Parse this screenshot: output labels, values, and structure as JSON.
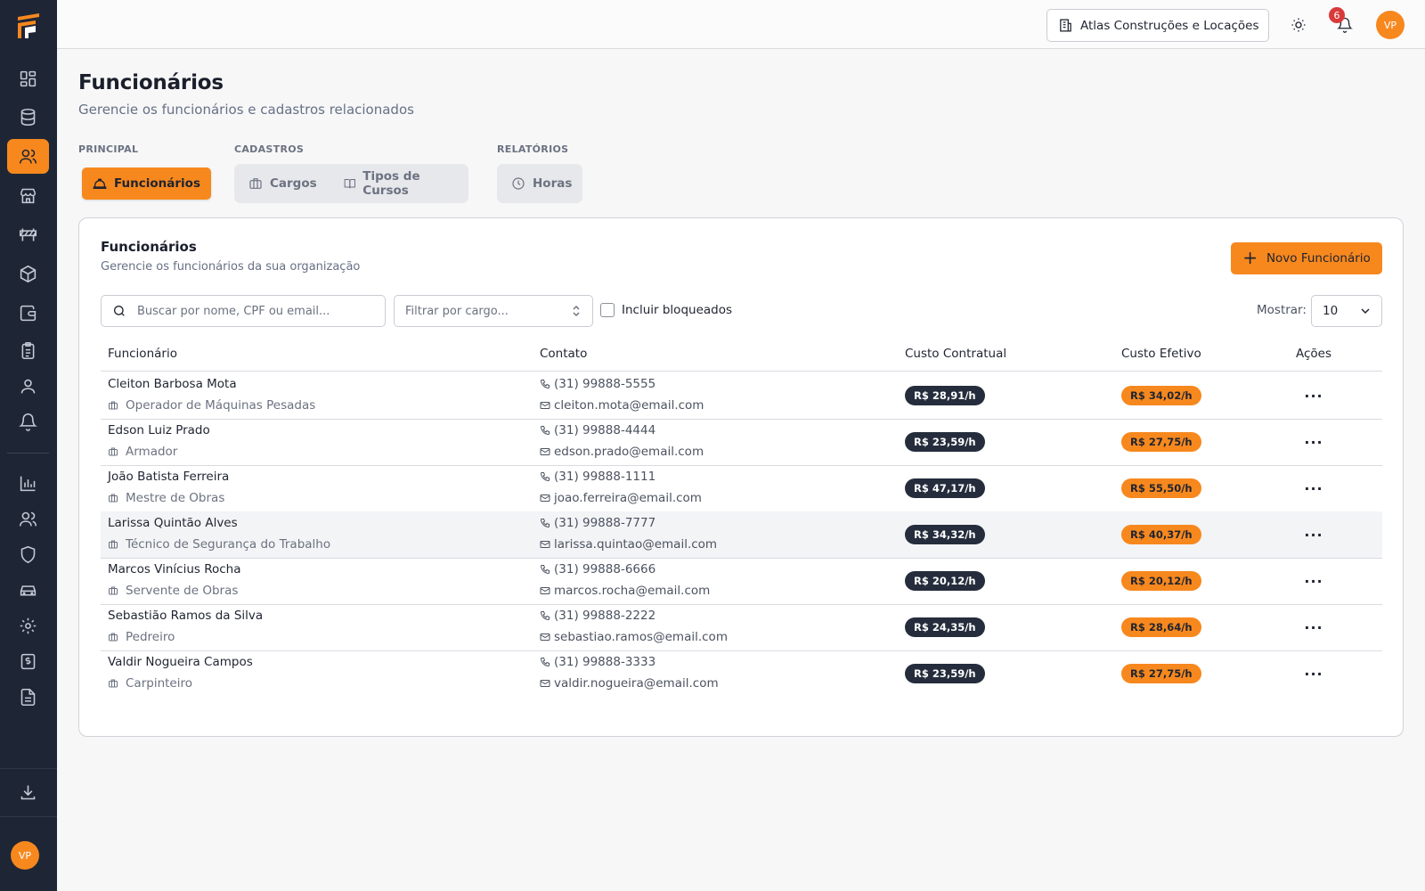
{
  "header": {
    "org_name": "Atlas Construções e Locações",
    "notification_count": "6",
    "user_initials": "VP"
  },
  "sidebar": {
    "user_initials": "VP",
    "items": [
      {
        "icon": "dashboard-icon"
      },
      {
        "icon": "database-icon"
      },
      {
        "icon": "users-icon",
        "active": true
      },
      {
        "icon": "store-icon"
      },
      {
        "icon": "barrier-icon"
      },
      {
        "icon": "box-icon"
      },
      {
        "icon": "wallet-icon"
      },
      {
        "icon": "clipboard-icon"
      },
      {
        "icon": "user-icon"
      },
      {
        "icon": "bell-icon"
      },
      {
        "icon": "chart-icon"
      },
      {
        "icon": "team-icon"
      },
      {
        "icon": "shield-icon"
      },
      {
        "icon": "vehicle-icon"
      },
      {
        "icon": "gear-icon"
      },
      {
        "icon": "receipt-icon"
      },
      {
        "icon": "document-icon"
      },
      {
        "icon": "download-icon"
      }
    ]
  },
  "page": {
    "title": "Funcionários",
    "subtitle": "Gerencie os funcionários e cadastros relacionados"
  },
  "tab_groups": [
    {
      "label": "PRINCIPAL",
      "tabs": [
        "Funcionários"
      ]
    },
    {
      "label": "CADASTROS",
      "tabs": [
        "Cargos",
        "Tipos de Cursos"
      ]
    },
    {
      "label": "RELATÓRIOS",
      "tabs": [
        "Horas"
      ]
    }
  ],
  "card": {
    "title": "Funcionários",
    "subtitle": "Gerencie os funcionários da sua organização",
    "new_button": "Novo Funcionário",
    "search_placeholder": "Buscar por nome, CPF ou email...",
    "filter_placeholder": "Filtrar por cargo...",
    "include_blocked": "Incluir bloqueados",
    "show_label": "Mostrar:",
    "show_value": "10"
  },
  "table": {
    "columns": [
      "Funcionário",
      "Contato",
      "Custo Contratual",
      "Custo Efetivo",
      "Ações"
    ],
    "rows": [
      {
        "name": "Cleiton Barbosa Mota",
        "role": "Operador de Máquinas Pesadas",
        "phone": "(31) 99888-5555",
        "email": "cleiton.mota@email.com",
        "contract_cost": "R$ 28,91/h",
        "effective_cost": "R$ 34,02/h"
      },
      {
        "name": "Edson Luiz Prado",
        "role": "Armador",
        "phone": "(31) 99888-4444",
        "email": "edson.prado@email.com",
        "contract_cost": "R$ 23,59/h",
        "effective_cost": "R$ 27,75/h"
      },
      {
        "name": "João Batista Ferreira",
        "role": "Mestre de Obras",
        "phone": "(31) 99888-1111",
        "email": "joao.ferreira@email.com",
        "contract_cost": "R$ 47,17/h",
        "effective_cost": "R$ 55,50/h"
      },
      {
        "name": "Larissa Quintão Alves",
        "role": "Técnico de Segurança do Trabalho",
        "phone": "(31) 99888-7777",
        "email": "larissa.quintao@email.com",
        "contract_cost": "R$ 34,32/h",
        "effective_cost": "R$ 40,37/h"
      },
      {
        "name": "Marcos Vinícius Rocha",
        "role": "Servente de Obras",
        "phone": "(31) 99888-6666",
        "email": "marcos.rocha@email.com",
        "contract_cost": "R$ 20,12/h",
        "effective_cost": "R$ 20,12/h"
      },
      {
        "name": "Sebastião Ramos da Silva",
        "role": "Pedreiro",
        "phone": "(31) 99888-2222",
        "email": "sebastiao.ramos@email.com",
        "contract_cost": "R$ 24,35/h",
        "effective_cost": "R$ 28,64/h"
      },
      {
        "name": "Valdir Nogueira Campos",
        "role": "Carpinteiro",
        "phone": "(31) 99888-3333",
        "email": "valdir.nogueira@email.com",
        "contract_cost": "R$ 23,59/h",
        "effective_cost": "R$ 27,75/h"
      }
    ]
  },
  "colors": {
    "accent": "#f7881e",
    "sidebar_bg": "#1e2636",
    "pill_dark": "#252d3d",
    "badge_red": "#d93a3a"
  }
}
